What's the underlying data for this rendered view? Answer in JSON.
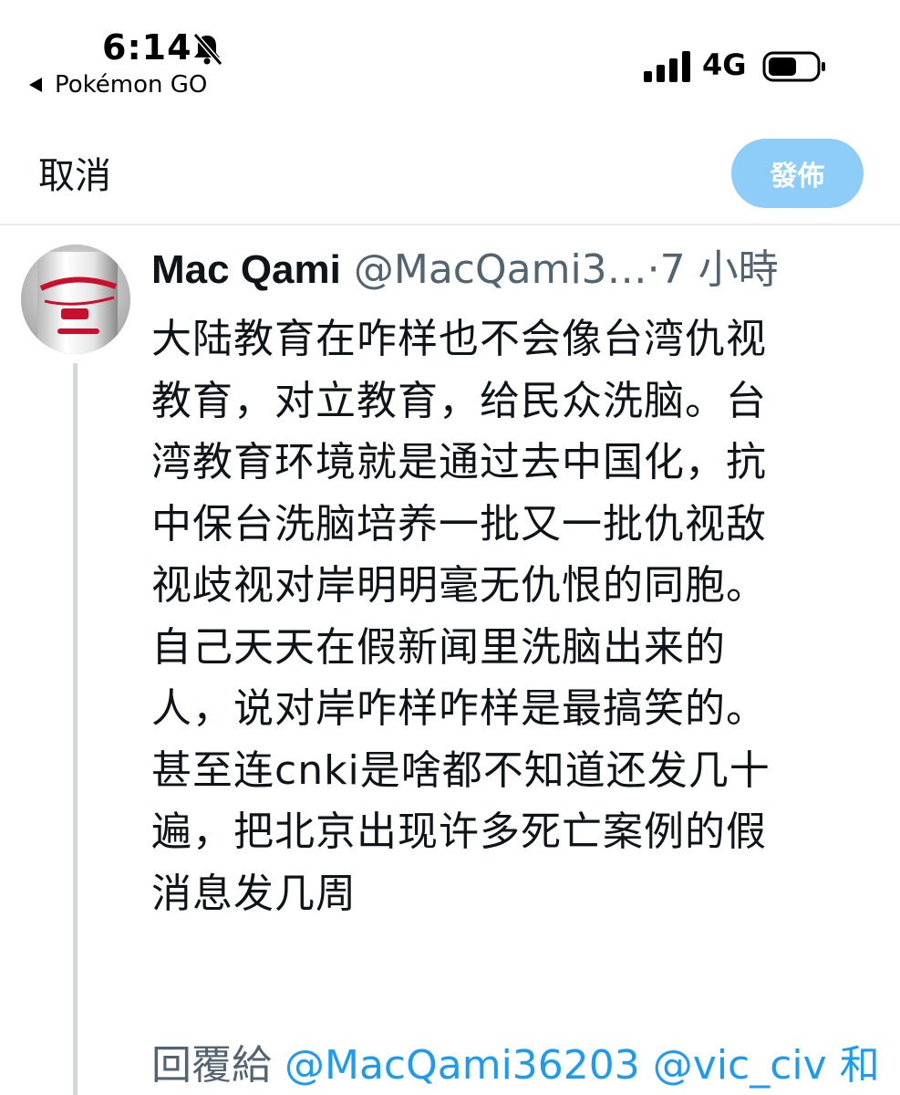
{
  "status_bar": {
    "time": "6:14",
    "back_app": "Pokémon GO",
    "network": "4G",
    "icons": [
      "bell-slash-icon",
      "cellular-signal-icon",
      "battery-icon"
    ]
  },
  "compose": {
    "cancel_label": "取消",
    "post_label": "發佈",
    "post_button_color": "#8ecdf8"
  },
  "tweet": {
    "author_name": "Mac Qami",
    "author_handle": "@MacQami3…",
    "separator": "·",
    "time_ago": "7 小時",
    "body_lines": [
      "大陆教育在咋样也不会像台湾仇视",
      "教育，对立教育，给民众洗脑。台",
      "湾教育环境就是通过去中国化，抗",
      "中保台洗脑培养一批又一批仇视敌",
      "视歧视对岸明明毫无仇恨的同胞。",
      "自己天天在假新闻里洗脑出来的",
      "人，说对岸咋样咋样是最搞笑的。",
      "甚至连cnki是啥都不知道还发几十",
      "遍，把北京出现许多死亡案例的假",
      "消息发几周"
    ],
    "reply_prefix": "回覆給",
    "reply_mention_1": "@MacQami36203",
    "reply_mention_2": "@vic_civ",
    "reply_suffix": "和",
    "link_color": "#1d9bf0"
  }
}
